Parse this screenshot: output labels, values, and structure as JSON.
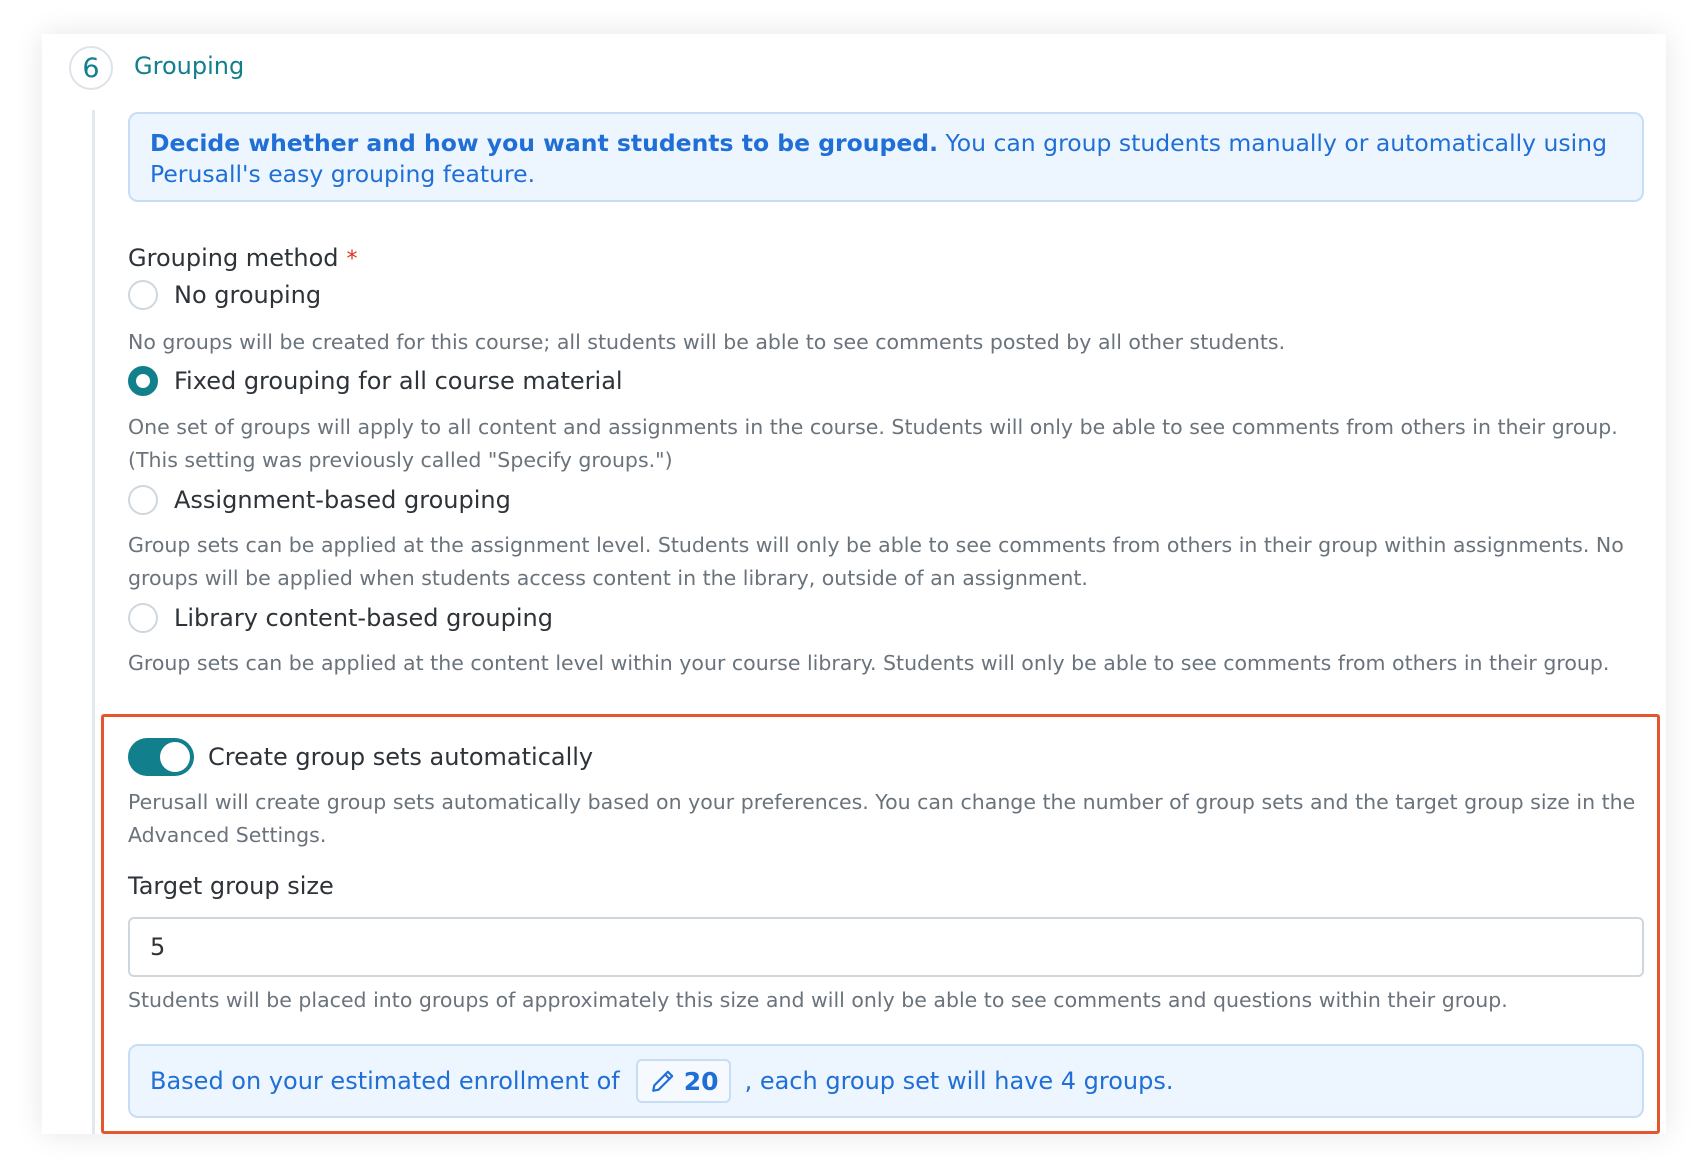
{
  "section": {
    "number": "6",
    "title": "Grouping"
  },
  "intro": {
    "bold": "Decide whether and how you want students to be grouped.",
    "text": " You can group students manually or automatically using Perusall's easy grouping feature."
  },
  "grouping_method": {
    "label": "Grouping method",
    "required_mark": "*",
    "selected": "fixed",
    "options": [
      {
        "id": "none",
        "label": "No grouping",
        "help": "No groups will be created for this course; all students will be able to see comments posted by all other students."
      },
      {
        "id": "fixed",
        "label": "Fixed grouping for all course material",
        "help": "One set of groups will apply to all content and assignments in the course. Students will only be able to see comments from others in their group. (This setting was previously called \"Specify groups.\")"
      },
      {
        "id": "assignment",
        "label": "Assignment-based grouping",
        "help": "Group sets can be applied at the assignment level. Students will only be able to see comments from others in their group within assignments. No groups will be applied when students access content in the library, outside of an assignment."
      },
      {
        "id": "library",
        "label": "Library content-based grouping",
        "help": "Group sets can be applied at the content level within your course library. Students will only be able to see comments from others in their group."
      }
    ]
  },
  "auto_groups": {
    "enabled": true,
    "label": "Create group sets automatically",
    "help": "Perusall will create group sets automatically based on your preferences. You can change the number of group sets and the target group size in the Advanced Settings."
  },
  "target_size": {
    "label": "Target group size",
    "value": "5",
    "help": "Students will be placed into groups of approximately this size and will only be able to see comments and questions within their group."
  },
  "enrollment": {
    "prefix": "Based on your estimated enrollment of",
    "value": "20",
    "suffix": ", each group set will have 4 groups.",
    "icon": "pencil-icon"
  },
  "colors": {
    "accent": "#127f8c",
    "info_text": "#1f6fd6",
    "info_bg": "#edf5fe",
    "highlight": "#e4572e"
  }
}
